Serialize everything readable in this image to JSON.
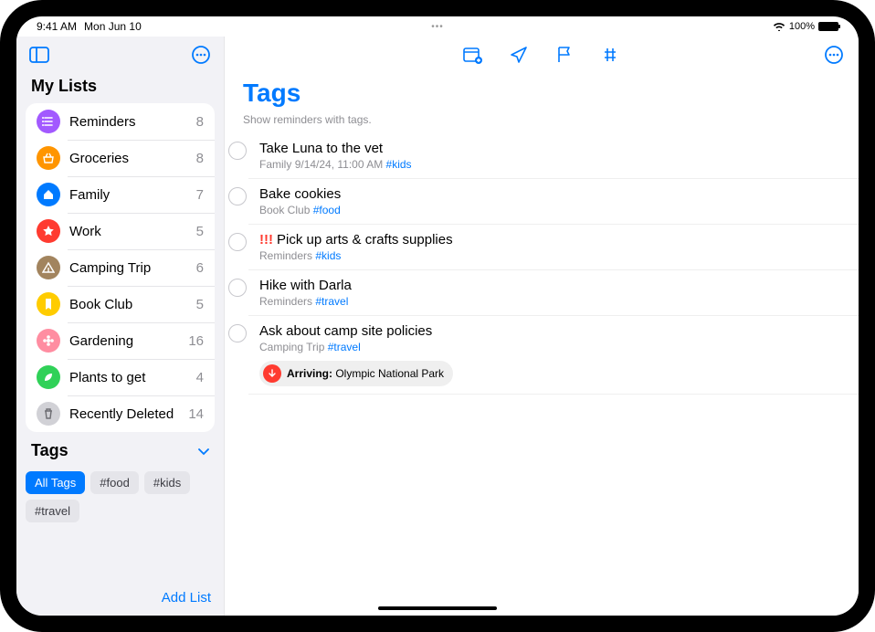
{
  "status": {
    "time": "9:41 AM",
    "date": "Mon Jun 10",
    "battery_pct": "100%"
  },
  "sidebar": {
    "header": "My Lists",
    "lists": [
      {
        "name": "Reminders",
        "count": "8",
        "color": "#a259ff",
        "icon": "hlist"
      },
      {
        "name": "Groceries",
        "count": "8",
        "color": "#ff9500",
        "icon": "basket"
      },
      {
        "name": "Family",
        "count": "7",
        "color": "#007aff",
        "icon": "house"
      },
      {
        "name": "Work",
        "count": "5",
        "color": "#ff3b30",
        "icon": "star"
      },
      {
        "name": "Camping Trip",
        "count": "6",
        "color": "#a2845e",
        "icon": "tent"
      },
      {
        "name": "Book Club",
        "count": "5",
        "color": "#ffcc00",
        "icon": "bookmark"
      },
      {
        "name": "Gardening",
        "count": "16",
        "color": "#ff8da1",
        "icon": "flower"
      },
      {
        "name": "Plants to get",
        "count": "4",
        "color": "#30d158",
        "icon": "leaf"
      },
      {
        "name": "Recently Deleted",
        "count": "14",
        "color": "#d1d1d6",
        "icon": "trash"
      }
    ],
    "tags_header": "Tags",
    "tags": [
      {
        "label": "All Tags",
        "selected": true
      },
      {
        "label": "#food",
        "selected": false
      },
      {
        "label": "#kids",
        "selected": false
      },
      {
        "label": "#travel",
        "selected": false
      }
    ],
    "add_list": "Add List"
  },
  "main": {
    "title": "Tags",
    "subtitle": "Show reminders with tags.",
    "reminders": [
      {
        "title": "Take Luna to the vet",
        "meta_list": "Family",
        "meta_extra": "9/14/24, 11:00 AM",
        "tag": "#kids",
        "priority": ""
      },
      {
        "title": "Bake cookies",
        "meta_list": "Book Club",
        "meta_extra": "",
        "tag": "#food",
        "priority": ""
      },
      {
        "title": "Pick up arts & crafts supplies",
        "meta_list": "Reminders",
        "meta_extra": "",
        "tag": "#kids",
        "priority": "!!!"
      },
      {
        "title": "Hike with Darla",
        "meta_list": "Reminders",
        "meta_extra": "",
        "tag": "#travel",
        "priority": ""
      },
      {
        "title": "Ask about camp site policies",
        "meta_list": "Camping Trip",
        "meta_extra": "",
        "tag": "#travel",
        "priority": "",
        "location_label": "Arriving:",
        "location_value": " Olympic National Park"
      }
    ]
  }
}
